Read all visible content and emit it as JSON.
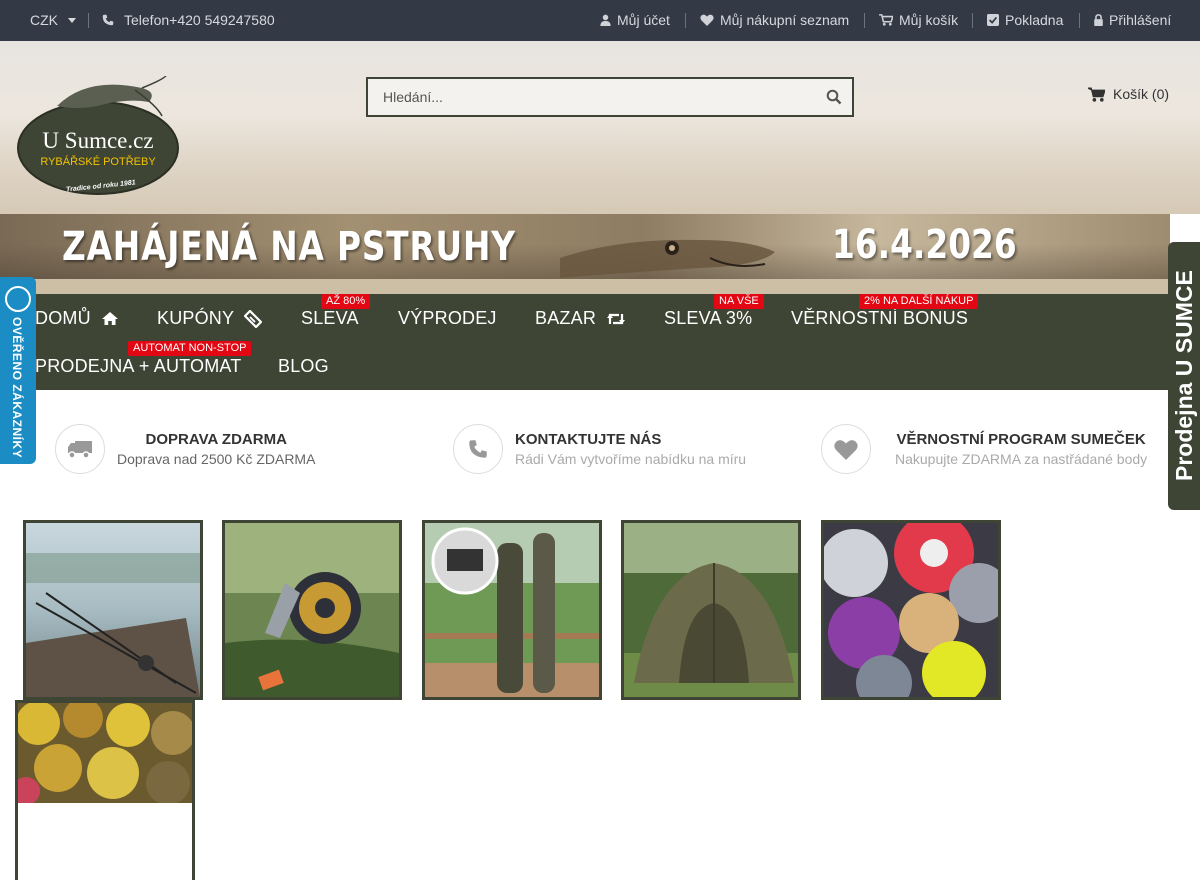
{
  "topbar": {
    "currency": "CZK",
    "phone": "Telefon+420 549247580",
    "account": "Můj účet",
    "wishlist": "Můj nákupní seznam",
    "cart": "Můj košík",
    "checkout": "Pokladna",
    "login": "Přihlášení"
  },
  "logo": {
    "name": "U Sumce.cz",
    "tagline": "RYBÁŘSKÉ POTŘEBY",
    "since": "Tradice od roku 1981"
  },
  "search": {
    "placeholder": "Hledání..."
  },
  "cart": {
    "label": "Košík (0)"
  },
  "banner": {
    "headline": "ZAHÁJENÁ NA PSTRUHY",
    "date": "16.4.2026"
  },
  "nav": {
    "items": [
      {
        "label": "DOMŮ",
        "icon": "home-icon"
      },
      {
        "label": "KUPÓNY",
        "icon": "ticket-icon"
      },
      {
        "label": "SLEVA",
        "badge": "AŽ 80%"
      },
      {
        "label": "VÝPRODEJ"
      },
      {
        "label": "BAZAR",
        "icon": "retweet-icon"
      },
      {
        "label": "SLEVA 3%",
        "badge": "NA VŠE"
      },
      {
        "label": "VĚRNOSTNÍ BONUS",
        "badge": "2% NA DALŠÍ NÁKUP"
      },
      {
        "label": "PRODEJNA + AUTOMAT",
        "badge": "AUTOMAT NON-STOP"
      },
      {
        "label": "BLOG"
      }
    ]
  },
  "trust_badge": {
    "label": "OVĚŘENO ZÁKAZNÍKY"
  },
  "shop_tab": {
    "label": "Prodejna U SUMCE"
  },
  "features": [
    {
      "icon": "truck-icon",
      "title": "DOPRAVA ZDARMA",
      "subtitle": "Doprava nad 2500 Kč ZDARMA"
    },
    {
      "icon": "phone-icon",
      "title": "KONTAKTUJTE NÁS",
      "subtitle": "Rádi Vám vytvoříme nabídku na míru"
    },
    {
      "icon": "heart-icon",
      "title": "VĚRNOSTNÍ PROGRAM SUMEČEK",
      "subtitle": "Nakupujte ZDARMA za nastřádané body"
    }
  ],
  "colors": {
    "topbar": "#333a45",
    "nav": "#3f4535",
    "badge": "#e30613",
    "trust": "#1b8cc4"
  }
}
